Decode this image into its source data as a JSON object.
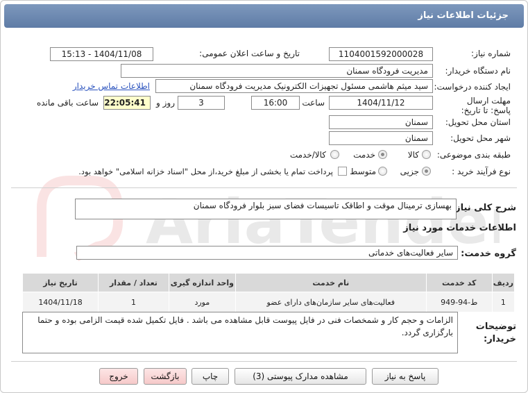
{
  "header": {
    "title": "جزئیات اطلاعات نیاز"
  },
  "form": {
    "need_number_label": "شماره نیاز:",
    "need_number": "1104001592000028",
    "announce_label": "تاریخ و ساعت اعلان عمومی:",
    "announce_value": "1404/11/08 - 15:13",
    "buyer_org_label": "نام دستگاه خریدار:",
    "buyer_org": "مدیریت فرودگاه سمنان",
    "creator_label": "ایجاد کننده درخواست:",
    "creator": "سید میثم هاشمی مسئول تجهیزات الکترونیک مدیریت فرودگاه سمنان",
    "contact_link": "اطلاعات تماس خریدار",
    "deadline_label": "مهلت ارسال پاسخ: تا تاریخ:",
    "deadline_date": "1404/11/12",
    "time_label": "ساعت",
    "deadline_time": "16:00",
    "days": "3",
    "days_label": "روز و",
    "remaining": "22:05:41",
    "remaining_label": "ساعت باقی مانده",
    "province_label": "استان محل تحویل:",
    "province": "سمنان",
    "city_label": "شهر محل تحویل:",
    "city": "سمنان",
    "category_label": "طبقه بندی موضوعی:",
    "category_options": [
      "کالا",
      "خدمت",
      "کالا/خدمت"
    ],
    "category_selected": "خدمت",
    "process_label": "نوع فرآیند خرید :",
    "process_options": [
      "جزیی",
      "متوسط"
    ],
    "process_selected": "جزیی",
    "payment_text": "پرداخت تمام یا بخشی از مبلغ خرید،از محل \"اسناد خزانه اسلامی\" خواهد بود."
  },
  "summary": {
    "label": "شرح کلی نیاز:",
    "text": "بهسازی ترمینال موقت و اطاقک تاسیسات فضای سبز بلوار فرودگاه سمنان"
  },
  "services": {
    "section_title": "اطلاعات خدمات مورد نیاز",
    "group_label": "گروه خدمت:",
    "group_value": "سایر فعالیت‌های خدماتی",
    "columns": [
      "ردیف",
      "کد خدمت",
      "نام خدمت",
      "واحد اندازه گیری",
      "تعداد / مقدار",
      "تاریخ نیاز"
    ],
    "rows": [
      {
        "index": "1",
        "code": "ط-94-949",
        "name": "فعالیت‌های سایر سازمان‌های دارای عضو",
        "unit": "مورد",
        "qty": "1",
        "date": "1404/11/18"
      }
    ]
  },
  "buyer_notes": {
    "label": "توضیحات خریدار:",
    "text": "الزامات و حجم کار و شمخصات فنی در فایل پیوست قابل مشاهده می باشد .  فایل تکمیل شده قیمت الزامی بوده و حتما بارگزاری گردد."
  },
  "buttons": {
    "reply": "پاسخ به نیاز",
    "attachments": "مشاهده مدارک پیوستی (3)",
    "print": "چاپ",
    "back": "بازگشت",
    "exit": "خروج"
  },
  "watermark_text": "AriaTender.net",
  "colors": {
    "titlebar": "#6b87b0",
    "highlight": "#ffffcc",
    "link": "#2a52be",
    "pink_button": "#f6c9c9"
  }
}
